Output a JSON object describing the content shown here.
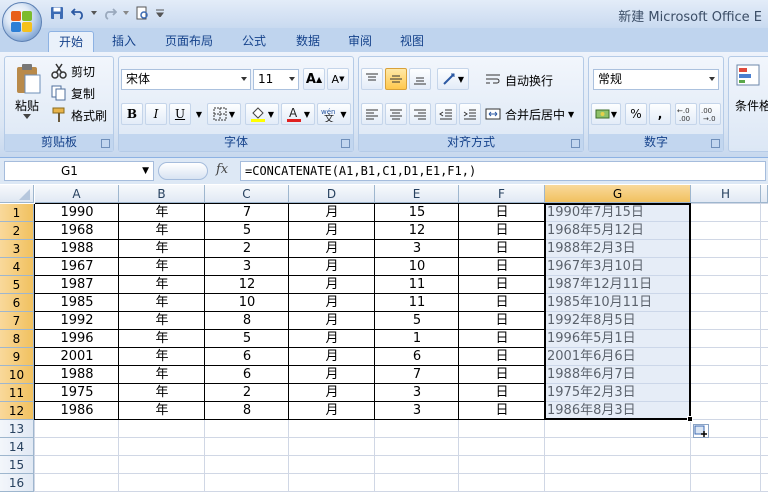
{
  "window": {
    "title": "新建 Microsoft Office E"
  },
  "tabs": [
    "开始",
    "插入",
    "页面布局",
    "公式",
    "数据",
    "审阅",
    "视图"
  ],
  "clipboard": {
    "paste": "粘贴",
    "cut": "剪切",
    "copy": "复制",
    "format_painter": "格式刷",
    "label": "剪贴板"
  },
  "font": {
    "name": "宋体",
    "size": "11",
    "bold": "B",
    "italic": "I",
    "underline": "U",
    "label": "字体",
    "grow": "A",
    "shrink": "A"
  },
  "alignment": {
    "wrap_text": "自动换行",
    "merge_center": "合并后居中",
    "label": "对齐方式"
  },
  "number": {
    "format": "常规",
    "percent": "%",
    "label": "数字"
  },
  "styles": {
    "conditional": "条件格"
  },
  "formula_bar": {
    "name_box": "G1",
    "fx": "fx",
    "formula": "=CONCATENATE(A1,B1,C1,D1,E1,F1,)"
  },
  "columns": [
    "A",
    "B",
    "C",
    "D",
    "E",
    "F",
    "G",
    "H"
  ],
  "row_numbers": [
    "1",
    "2",
    "3",
    "4",
    "5",
    "6",
    "7",
    "8",
    "9",
    "10",
    "11",
    "12",
    "13",
    "14",
    "15",
    "16"
  ],
  "rows": [
    [
      "1990",
      "年",
      "7",
      "月",
      "15",
      "日",
      "1990年7月15日"
    ],
    [
      "1968",
      "年",
      "5",
      "月",
      "12",
      "日",
      "1968年5月12日"
    ],
    [
      "1988",
      "年",
      "2",
      "月",
      "3",
      "日",
      "1988年2月3日"
    ],
    [
      "1967",
      "年",
      "3",
      "月",
      "10",
      "日",
      "1967年3月10日"
    ],
    [
      "1987",
      "年",
      "12",
      "月",
      "11",
      "日",
      "1987年12月11日"
    ],
    [
      "1985",
      "年",
      "10",
      "月",
      "11",
      "日",
      "1985年10月11日"
    ],
    [
      "1992",
      "年",
      "8",
      "月",
      "5",
      "日",
      "1992年8月5日"
    ],
    [
      "1996",
      "年",
      "5",
      "月",
      "1",
      "日",
      "1996年5月1日"
    ],
    [
      "2001",
      "年",
      "6",
      "月",
      "6",
      "日",
      "2001年6月6日"
    ],
    [
      "1988",
      "年",
      "6",
      "月",
      "7",
      "日",
      "1988年6月7日"
    ],
    [
      "1975",
      "年",
      "2",
      "月",
      "3",
      "日",
      "1975年2月3日"
    ],
    [
      "1986",
      "年",
      "8",
      "月",
      "3",
      "日",
      "1986年8月3日"
    ]
  ],
  "colors": {
    "selection": "#e8edf7",
    "selection_border": "#000000",
    "header_sel": "#f1c15f",
    "ribbon_text": "#15428b"
  }
}
